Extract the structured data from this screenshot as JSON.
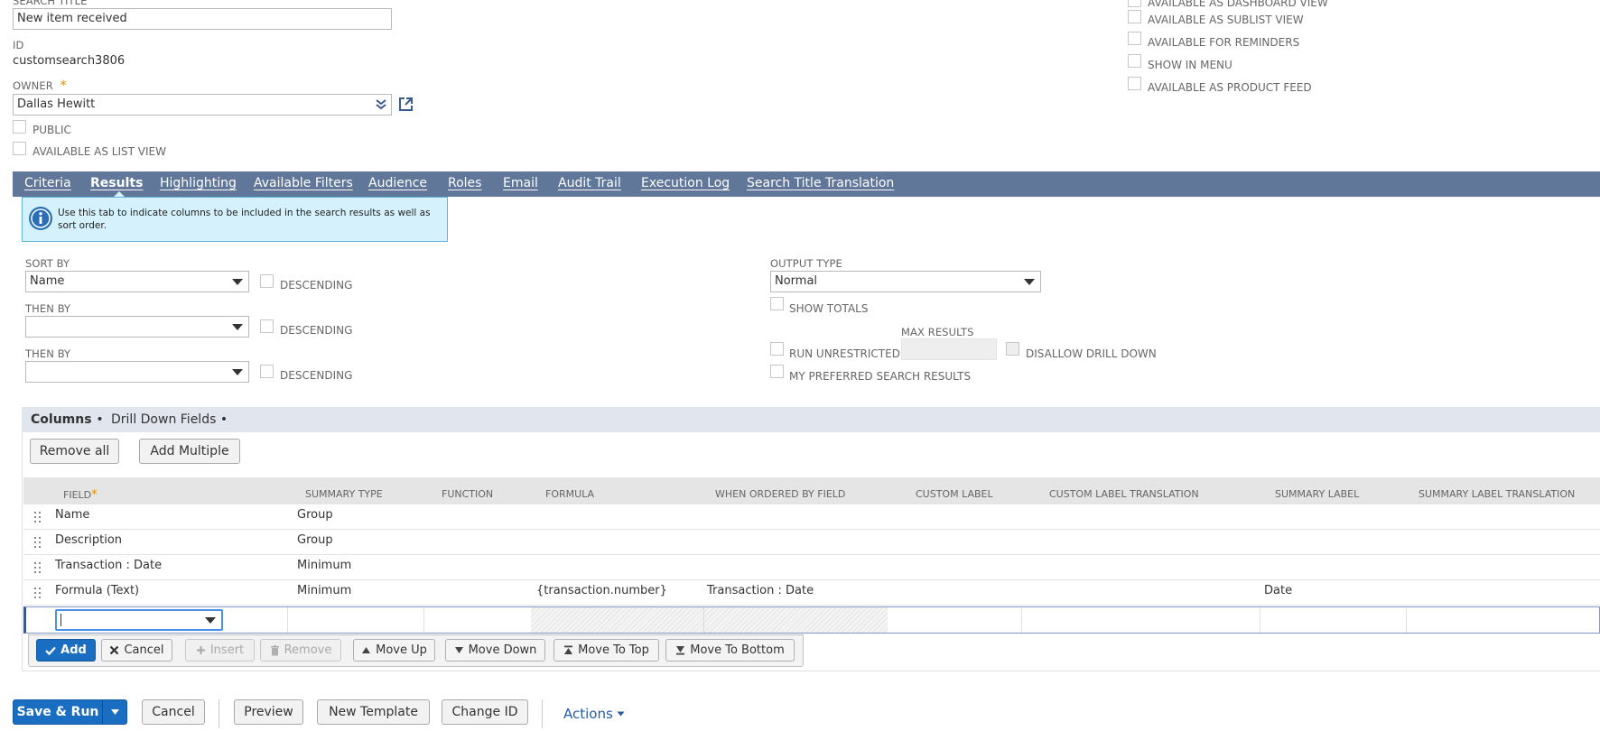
{
  "search_title": {
    "label": "SEARCH TITLE",
    "value": "New item received"
  },
  "id_field": {
    "label": "ID",
    "value": "customsearch3806"
  },
  "owner": {
    "label": "OWNER",
    "required_mark": "*",
    "value": "Dallas Hewitt"
  },
  "left_checkboxes": [
    {
      "label": "PUBLIC",
      "checked": false
    },
    {
      "label": "AVAILABLE AS LIST VIEW",
      "checked": false
    }
  ],
  "right_checkboxes": [
    {
      "label": "AVAILABLE AS DASHBOARD VIEW",
      "checked": false
    },
    {
      "label": "AVAILABLE AS SUBLIST VIEW",
      "checked": false
    },
    {
      "label": "AVAILABLE FOR REMINDERS",
      "checked": false
    },
    {
      "label": "SHOW IN MENU",
      "checked": false
    },
    {
      "label": "AVAILABLE AS PRODUCT FEED",
      "checked": false
    }
  ],
  "tabs": [
    {
      "label": "Criteria",
      "active": false
    },
    {
      "label": "Results",
      "active": true
    },
    {
      "label": "Highlighting",
      "active": false
    },
    {
      "label": "Available Filters",
      "active": false
    },
    {
      "label": "Audience",
      "active": false
    },
    {
      "label": "Roles",
      "active": false
    },
    {
      "label": "Email",
      "active": false
    },
    {
      "label": "Audit Trail",
      "active": false
    },
    {
      "label": "Execution Log",
      "active": false
    },
    {
      "label": "Search Title Translation",
      "active": false
    }
  ],
  "info_text": "Use this tab to indicate columns to be included in the search results as well as sort order.",
  "sort": {
    "sort_by_label": "SORT BY",
    "sort_by_value": "Name",
    "then_by_label": "THEN BY",
    "then_by_1_value": "",
    "then_by_2_value": "",
    "descending_label": "DESCENDING"
  },
  "output": {
    "output_type_label": "OUTPUT TYPE",
    "output_type_value": "Normal",
    "show_totals_label": "SHOW TOTALS",
    "max_results_label": "MAX RESULTS",
    "run_unrestricted_label": "RUN UNRESTRICTED",
    "disallow_drill_down_label": "DISALLOW DRILL DOWN",
    "preferred_results_label": "MY PREFERRED SEARCH RESULTS"
  },
  "subtabs": [
    {
      "label": "Columns",
      "suffix": "•",
      "active": true
    },
    {
      "label": "Drill Down Fields",
      "suffix": "•",
      "active": false
    }
  ],
  "column_buttons": {
    "remove_all": "Remove all",
    "add_multiple": "Add Multiple"
  },
  "table": {
    "headers": [
      "FIELD",
      "SUMMARY TYPE",
      "FUNCTION",
      "FORMULA",
      "WHEN ORDERED BY FIELD",
      "CUSTOM LABEL",
      "CUSTOM LABEL TRANSLATION",
      "SUMMARY LABEL",
      "SUMMARY LABEL TRANSLATION"
    ],
    "field_required_mark": "*",
    "rows": [
      {
        "field": "Name",
        "summary_type": "Group",
        "function": "",
        "formula": "",
        "when_ordered": "",
        "custom_label": "",
        "custom_label_translation": "",
        "summary_label": "",
        "summary_label_translation": ""
      },
      {
        "field": "Description",
        "summary_type": "Group",
        "function": "",
        "formula": "",
        "when_ordered": "",
        "custom_label": "",
        "custom_label_translation": "",
        "summary_label": "",
        "summary_label_translation": ""
      },
      {
        "field": "Transaction : Date",
        "summary_type": "Minimum",
        "function": "",
        "formula": "",
        "when_ordered": "",
        "custom_label": "",
        "custom_label_translation": "",
        "summary_label": "",
        "summary_label_translation": ""
      },
      {
        "field": "Formula (Text)",
        "summary_type": "Minimum",
        "function": "",
        "formula": "{transaction.number}",
        "when_ordered": "Transaction : Date",
        "custom_label": "",
        "custom_label_translation": "",
        "summary_label": "Date",
        "summary_label_translation": ""
      }
    ]
  },
  "row_actions": {
    "add": "Add",
    "cancel": "Cancel",
    "insert": "Insert",
    "remove": "Remove",
    "move_up": "Move Up",
    "move_down": "Move Down",
    "move_to_top": "Move To Top",
    "move_to_bottom": "Move To Bottom"
  },
  "footer": {
    "save_run": "Save & Run",
    "cancel": "Cancel",
    "preview": "Preview",
    "new_template": "New Template",
    "change_id": "Change ID",
    "actions": "Actions"
  },
  "colors": {
    "tab_bar": "#607799",
    "primary_button": "#1a6ec2",
    "info_bg": "#d5f1fb",
    "subtab_bar": "#e1e6ee",
    "required": "#e38f00",
    "link": "#255ba9"
  }
}
